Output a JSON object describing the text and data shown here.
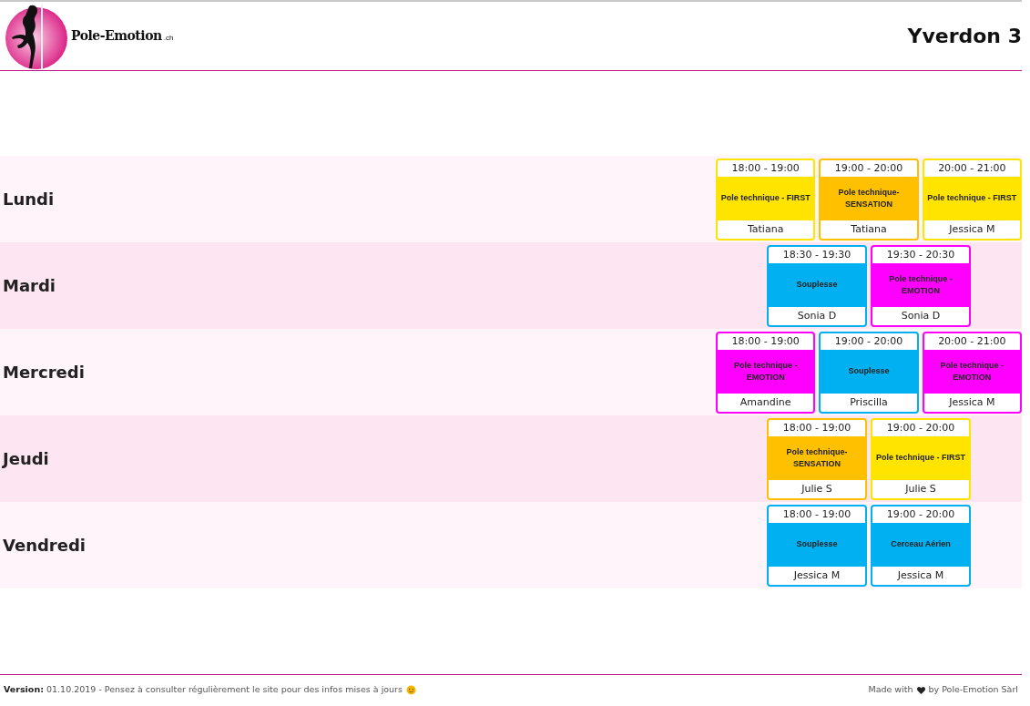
{
  "header": {
    "logo_text": "Pole-Emotion",
    "logo_suffix": ".ch",
    "title": "Yverdon 3"
  },
  "days": [
    {
      "name": "Lundi",
      "classes": [
        {
          "time": "18:00 - 19:00",
          "course": "Pole technique - FIRST",
          "teacher": "Tatiana",
          "color": "#ffe400"
        },
        {
          "time": "19:00 - 20:00",
          "course": "Pole technique- SENSATION",
          "teacher": "Tatiana",
          "color": "#ffc000"
        },
        {
          "time": "20:00 - 21:00",
          "course": "Pole technique - FIRST",
          "teacher": "Jessica M",
          "color": "#ffe400"
        }
      ]
    },
    {
      "name": "Mardi",
      "classes": [
        {
          "time": "18:30 - 19:30",
          "course": "Souplesse",
          "teacher": "Sonia D",
          "color": "#00b0f0"
        },
        {
          "time": "19:30 - 20:30",
          "course": "Pole technique - EMOTION",
          "teacher": "Sonia D",
          "color": "#ff00ff"
        }
      ]
    },
    {
      "name": "Mercredi",
      "classes": [
        {
          "time": "18:00 - 19:00",
          "course": "Pole technique - EMOTION",
          "teacher": "Amandine",
          "color": "#ff00ff"
        },
        {
          "time": "19:00 - 20:00",
          "course": "Souplesse",
          "teacher": "Priscilla",
          "color": "#00b0f0"
        },
        {
          "time": "20:00 - 21:00",
          "course": "Pole technique - EMOTION",
          "teacher": "Jessica M",
          "color": "#ff00ff"
        }
      ]
    },
    {
      "name": "Jeudi",
      "classes": [
        {
          "time": "18:00 - 19:00",
          "course": "Pole technique- SENSATION",
          "teacher": "Julie S",
          "color": "#ffc000"
        },
        {
          "time": "19:00 - 20:00",
          "course": "Pole technique - FIRST",
          "teacher": "Julie S",
          "color": "#ffe400"
        }
      ]
    },
    {
      "name": "Vendredi",
      "classes": [
        {
          "time": "18:00 - 19:00",
          "course": "Souplesse",
          "teacher": "Jessica M",
          "color": "#00b0f0"
        },
        {
          "time": "19:00 - 20:00",
          "course": "Cerceau Aérien",
          "teacher": "Jessica M",
          "color": "#00b0f0"
        }
      ]
    }
  ],
  "footer": {
    "version": "**Version:** 01.10.2019 - Pensez à consulter régulièrement le site pour des infos mises à jours",
    "credit_before": "Made with",
    "credit_after": "by Pole-Emotion Sàrl"
  }
}
